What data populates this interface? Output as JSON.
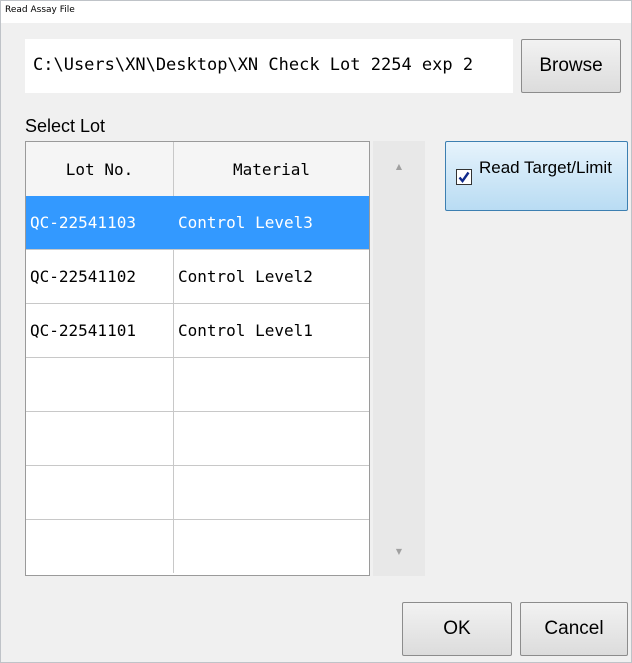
{
  "window": {
    "title": "Read Assay File"
  },
  "file": {
    "path": "C:\\Users\\XN\\Desktop\\XN Check Lot 2254 exp 2",
    "browse_label": "Browse"
  },
  "select_lot": {
    "label": "Select Lot",
    "columns": [
      "Lot No.",
      "Material"
    ],
    "rows": [
      {
        "lot": "QC-22541103",
        "material": "Control Level3",
        "selected": true
      },
      {
        "lot": "QC-22541102",
        "material": "Control Level2",
        "selected": false
      },
      {
        "lot": "QC-22541101",
        "material": "Control Level1",
        "selected": false
      },
      {
        "lot": "",
        "material": "",
        "selected": false
      },
      {
        "lot": "",
        "material": "",
        "selected": false
      },
      {
        "lot": "",
        "material": "",
        "selected": false
      },
      {
        "lot": "",
        "material": "",
        "selected": false
      }
    ]
  },
  "read_target": {
    "label": "Read Target/Limit",
    "checked": true
  },
  "buttons": {
    "ok_label": "OK",
    "cancel_label": "Cancel"
  },
  "colors": {
    "selection": "#3399ff",
    "dialog_background": "#f0f0f0",
    "toggle_fill": "#b9dcf3"
  }
}
